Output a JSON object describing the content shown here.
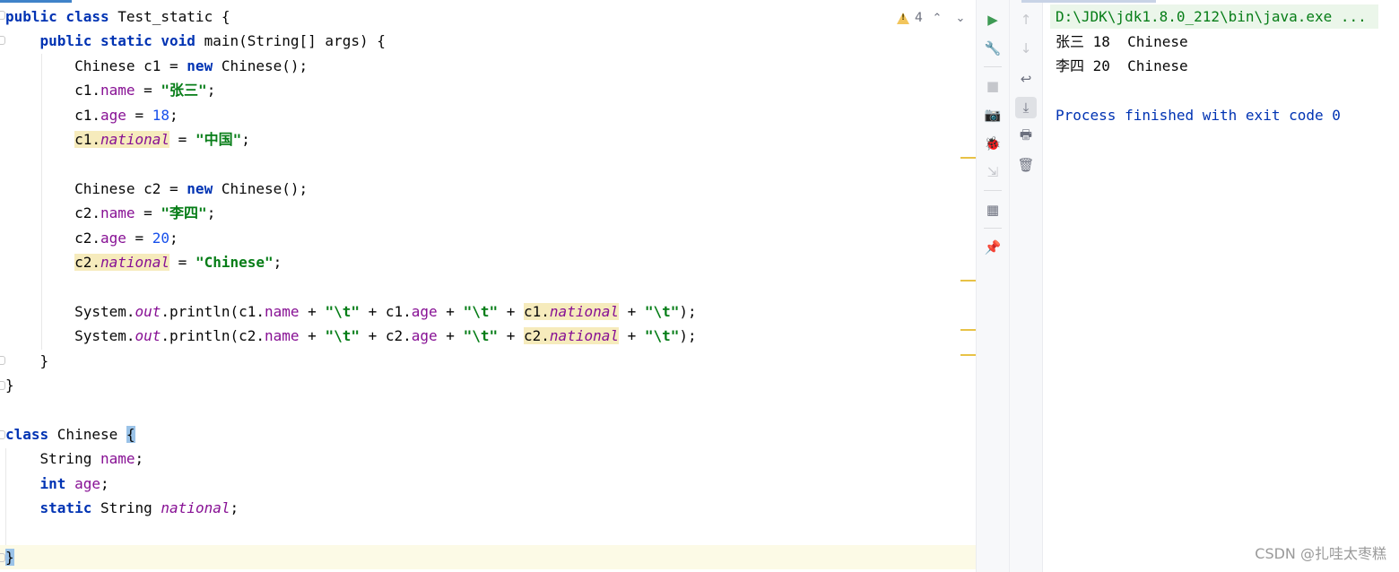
{
  "editor": {
    "lines": [
      [
        {
          "t": "public class ",
          "c": "kw"
        },
        {
          "t": "Test_static {",
          "c": ""
        }
      ],
      [
        {
          "t": "    ",
          "c": ""
        },
        {
          "t": "public static void ",
          "c": "kw"
        },
        {
          "t": "main(String[] args) {",
          "c": ""
        }
      ],
      [
        {
          "t": "        Chinese c1 = ",
          "c": ""
        },
        {
          "t": "new ",
          "c": "kw"
        },
        {
          "t": "Chinese();",
          "c": ""
        }
      ],
      [
        {
          "t": "        c1.",
          "c": ""
        },
        {
          "t": "name",
          "c": "fld"
        },
        {
          "t": " = ",
          "c": ""
        },
        {
          "t": "\"张三\"",
          "c": "str"
        },
        {
          "t": ";",
          "c": ""
        }
      ],
      [
        {
          "t": "        c1.",
          "c": ""
        },
        {
          "t": "age",
          "c": "fld"
        },
        {
          "t": " = ",
          "c": ""
        },
        {
          "t": "18",
          "c": "num"
        },
        {
          "t": ";",
          "c": ""
        }
      ],
      [
        {
          "t": "        ",
          "c": ""
        },
        {
          "t": "c1.",
          "c": "hl"
        },
        {
          "t": "national",
          "c": "sfld hl"
        },
        {
          "t": " = ",
          "c": ""
        },
        {
          "t": "\"中国\"",
          "c": "str"
        },
        {
          "t": ";",
          "c": ""
        }
      ],
      [],
      [
        {
          "t": "        Chinese c2 = ",
          "c": ""
        },
        {
          "t": "new ",
          "c": "kw"
        },
        {
          "t": "Chinese();",
          "c": ""
        }
      ],
      [
        {
          "t": "        c2.",
          "c": ""
        },
        {
          "t": "name",
          "c": "fld"
        },
        {
          "t": " = ",
          "c": ""
        },
        {
          "t": "\"李四\"",
          "c": "str"
        },
        {
          "t": ";",
          "c": ""
        }
      ],
      [
        {
          "t": "        c2.",
          "c": ""
        },
        {
          "t": "age",
          "c": "fld"
        },
        {
          "t": " = ",
          "c": ""
        },
        {
          "t": "20",
          "c": "num"
        },
        {
          "t": ";",
          "c": ""
        }
      ],
      [
        {
          "t": "        ",
          "c": ""
        },
        {
          "t": "c2.",
          "c": "hl"
        },
        {
          "t": "national",
          "c": "sfld hl"
        },
        {
          "t": " = ",
          "c": ""
        },
        {
          "t": "\"Chinese\"",
          "c": "str"
        },
        {
          "t": ";",
          "c": ""
        }
      ],
      [],
      [
        {
          "t": "        System.",
          "c": ""
        },
        {
          "t": "out",
          "c": "sfld"
        },
        {
          "t": ".println(c1.",
          "c": ""
        },
        {
          "t": "name",
          "c": "fld"
        },
        {
          "t": " + ",
          "c": ""
        },
        {
          "t": "\"\\t\"",
          "c": "str"
        },
        {
          "t": " + c1.",
          "c": ""
        },
        {
          "t": "age",
          "c": "fld"
        },
        {
          "t": " + ",
          "c": ""
        },
        {
          "t": "\"\\t\"",
          "c": "str"
        },
        {
          "t": " + ",
          "c": ""
        },
        {
          "t": "c1.",
          "c": "hl"
        },
        {
          "t": "national",
          "c": "sfld hl"
        },
        {
          "t": " + ",
          "c": ""
        },
        {
          "t": "\"\\t\"",
          "c": "str"
        },
        {
          "t": ");",
          "c": ""
        }
      ],
      [
        {
          "t": "        System.",
          "c": ""
        },
        {
          "t": "out",
          "c": "sfld"
        },
        {
          "t": ".println(c2.",
          "c": ""
        },
        {
          "t": "name",
          "c": "fld"
        },
        {
          "t": " + ",
          "c": ""
        },
        {
          "t": "\"\\t\"",
          "c": "str"
        },
        {
          "t": " + c2.",
          "c": ""
        },
        {
          "t": "age",
          "c": "fld"
        },
        {
          "t": " + ",
          "c": ""
        },
        {
          "t": "\"\\t\"",
          "c": "str"
        },
        {
          "t": " + ",
          "c": ""
        },
        {
          "t": "c2.",
          "c": "hl"
        },
        {
          "t": "national",
          "c": "sfld hl"
        },
        {
          "t": " + ",
          "c": ""
        },
        {
          "t": "\"\\t\"",
          "c": "str"
        },
        {
          "t": ");",
          "c": ""
        }
      ],
      [
        {
          "t": "    }",
          "c": ""
        }
      ],
      [
        {
          "t": "}",
          "c": ""
        }
      ],
      [],
      [
        {
          "t": "class ",
          "c": "kw"
        },
        {
          "t": "Chinese ",
          "c": ""
        },
        {
          "t": "{",
          "c": "brace"
        }
      ],
      [
        {
          "t": "    String ",
          "c": ""
        },
        {
          "t": "name",
          "c": "fld"
        },
        {
          "t": ";",
          "c": ""
        }
      ],
      [
        {
          "t": "    ",
          "c": ""
        },
        {
          "t": "int ",
          "c": "kw"
        },
        {
          "t": "age",
          "c": "fld"
        },
        {
          "t": ";",
          "c": ""
        }
      ],
      [
        {
          "t": "    ",
          "c": ""
        },
        {
          "t": "static ",
          "c": "kw"
        },
        {
          "t": "String ",
          "c": ""
        },
        {
          "t": "national",
          "c": "sfld"
        },
        {
          "t": ";",
          "c": ""
        }
      ],
      [],
      [
        {
          "t": "}",
          "c": "brace"
        }
      ]
    ],
    "warning_count": "4",
    "nav_up": "⌃",
    "nav_down": "⌄"
  },
  "run_toolbar": {
    "rerun_icon": "▶",
    "settings_icon": "🔧",
    "stop_icon": "■",
    "screenshot_icon": "📷",
    "debug_icon": "🐞",
    "exit_icon": "⇲",
    "layout_icon": "▦",
    "pin_icon": "📌"
  },
  "console_toolbar": {
    "up_icon": "↑",
    "down_icon": "↓",
    "wrap_icon": "↩",
    "scroll_end_icon": "⤓",
    "print_icon": "🖶",
    "trash_icon": "🗑"
  },
  "console": {
    "command": "D:\\JDK\\jdk1.8.0_212\\bin\\java.exe ...",
    "output": [
      "张三 18  Chinese",
      "李四 20  Chinese",
      ""
    ],
    "exit_message": "Process finished with exit code 0"
  },
  "watermark": "CSDN @扎哇太枣糕"
}
